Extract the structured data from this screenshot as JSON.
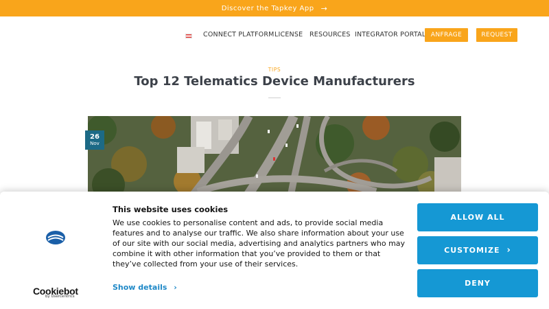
{
  "topbar": {
    "text": "Discover the Tapkey App",
    "arrow": "→"
  },
  "nav": {
    "flag_icon": "austria-flag-icon",
    "links": [
      "CONNECT PLATFORM",
      "LICENSE",
      "RESOURCES",
      "INTEGRATOR PORTAL"
    ],
    "buttons": [
      "ANFRAGE",
      "REQUEST"
    ]
  },
  "article": {
    "category": "TIPS",
    "title": "Top 12 Telematics Device Manufacturers",
    "date_day": "26",
    "date_month": "Nov"
  },
  "cookie": {
    "title": "This website uses cookies",
    "body": "We use cookies to personalise content and ads, to provide social media features and to analyse our traffic. We also share information about your use of our site with our social media, advertising and analytics partners who may combine it with other information that you’ve provided to them or that they’ve collected from your use of their services.",
    "details_label": "Show details",
    "details_chevron": "›",
    "brand_name": "Cookiebot",
    "brand_sub": "by Usercentrics",
    "allow_label": "ALLOW ALL",
    "customize_label": "CUSTOMIZE",
    "customize_chevron": "›",
    "deny_label": "DENY"
  },
  "colors": {
    "accent_orange": "#f9a51b",
    "cookie_blue": "#1598d4",
    "date_badge": "#1c6a86"
  }
}
